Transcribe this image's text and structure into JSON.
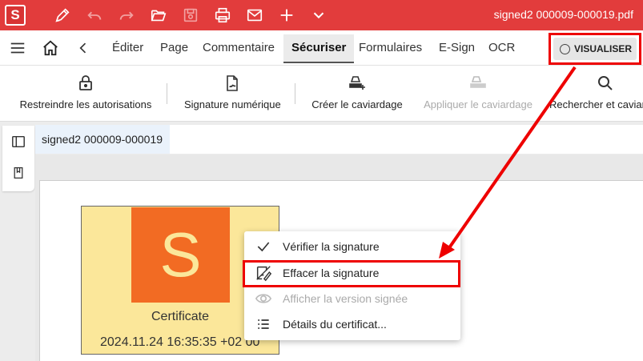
{
  "app": {
    "logo_letter": "S",
    "file_title": "signed2 000009-000019.pdf"
  },
  "toolbar_icons": [
    "pen-icon",
    "undo-icon",
    "redo-icon",
    "open-folder-icon",
    "save-icon",
    "print-icon",
    "email-icon",
    "plus-icon",
    "chevron-down-icon"
  ],
  "menubar": {
    "tabs": [
      "Éditer",
      "Page",
      "Commentaire",
      "Sécuriser",
      "Formulaires",
      "E-Sign",
      "OCR"
    ],
    "active_tab": "Sécuriser",
    "view_button": "VISUALISER"
  },
  "ribbon": {
    "items": [
      {
        "label": "Restreindre les autorisations",
        "icon": "lock-icon",
        "enabled": true
      },
      {
        "label": "Signature numérique",
        "icon": "signature-document-icon",
        "enabled": true
      },
      {
        "label": "Créer le caviardage",
        "icon": "redact-create-icon",
        "enabled": true
      },
      {
        "label": "Appliquer le caviardage",
        "icon": "redact-apply-icon",
        "enabled": false
      },
      {
        "label": "Rechercher et caviar",
        "icon": "search-icon",
        "enabled": true
      }
    ]
  },
  "document": {
    "tab_name": "signed2 000009-000019"
  },
  "signature": {
    "logo_letter": "S",
    "caption": "Certificate",
    "date": "2024.11.24 16:35:35 +02 00"
  },
  "context_menu": {
    "items": [
      {
        "label": "Vérifier la signature",
        "icon": "check-icon",
        "enabled": true
      },
      {
        "label": "Effacer la signature",
        "icon": "erase-signature-icon",
        "enabled": true
      },
      {
        "label": "Afficher la version signée",
        "icon": "eye-icon",
        "enabled": false
      },
      {
        "label": "Détails du certificat...",
        "icon": "list-icon",
        "enabled": true
      }
    ]
  },
  "colors": {
    "titlebar": "#e23c3c",
    "highlight_border": "#ee0000",
    "signature_bg": "#fbe79a",
    "signature_logo": "#f26b23",
    "doc_tab_bg": "#eaf2fb"
  }
}
